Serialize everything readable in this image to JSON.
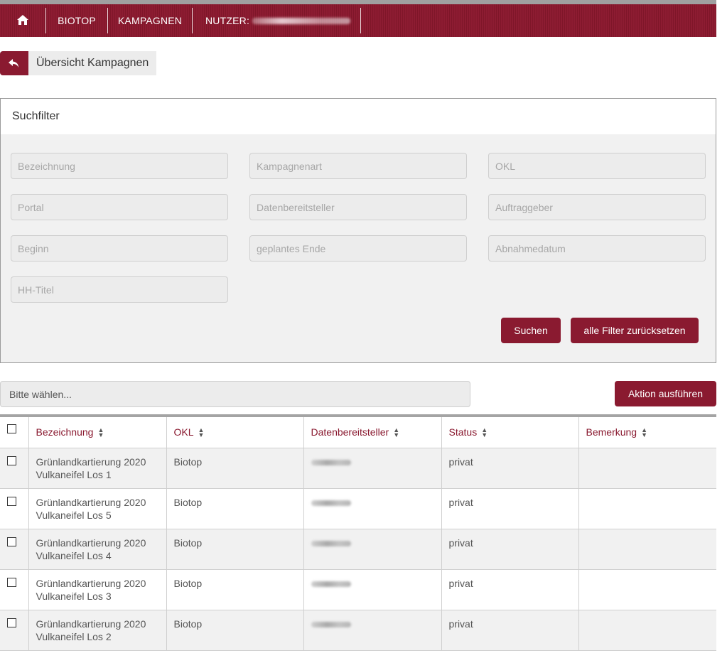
{
  "nav": {
    "home_icon": "home-icon",
    "items": [
      "BIOTOP",
      "KAMPAGNEN"
    ],
    "user_label": "NUTZER:"
  },
  "back": {
    "icon": "reply-arrow-icon",
    "label": "Übersicht Kampagnen"
  },
  "filter": {
    "title": "Suchfilter",
    "fields": [
      "Bezeichnung",
      "Kampagnenart",
      "OKL",
      "Portal",
      "Datenbereitsteller",
      "Auftraggeber",
      "Beginn",
      "geplantes Ende",
      "Abnahmedatum",
      "HH-Titel"
    ],
    "search_button": "Suchen",
    "reset_button": "alle Filter zurücksetzen"
  },
  "action": {
    "select_placeholder": "Bitte wählen...",
    "button": "Aktion ausführen"
  },
  "table": {
    "columns": [
      "Bezeichnung",
      "OKL",
      "Datenbereitsteller",
      "Status",
      "Bemerkung"
    ],
    "sort_icon": "sort-updown-icon",
    "rows": [
      {
        "bezeichnung_1": "Grünlandkartierung 2020",
        "bezeichnung_2": "Vulkaneifel Los 1",
        "okl": "Biotop",
        "status": "privat",
        "bemerkung": ""
      },
      {
        "bezeichnung_1": "Grünlandkartierung 2020",
        "bezeichnung_2": "Vulkaneifel Los 5",
        "okl": "Biotop",
        "status": "privat",
        "bemerkung": ""
      },
      {
        "bezeichnung_1": "Grünlandkartierung 2020",
        "bezeichnung_2": "Vulkaneifel Los 4",
        "okl": "Biotop",
        "status": "privat",
        "bemerkung": ""
      },
      {
        "bezeichnung_1": "Grünlandkartierung 2020",
        "bezeichnung_2": "Vulkaneifel Los 3",
        "okl": "Biotop",
        "status": "privat",
        "bemerkung": ""
      },
      {
        "bezeichnung_1": "Grünlandkartierung 2020",
        "bezeichnung_2": "Vulkaneifel Los 2",
        "okl": "Biotop",
        "status": "privat",
        "bemerkung": ""
      }
    ]
  },
  "colors": {
    "brand": "#8a1a30",
    "panel_bg": "#f1f1f1"
  }
}
